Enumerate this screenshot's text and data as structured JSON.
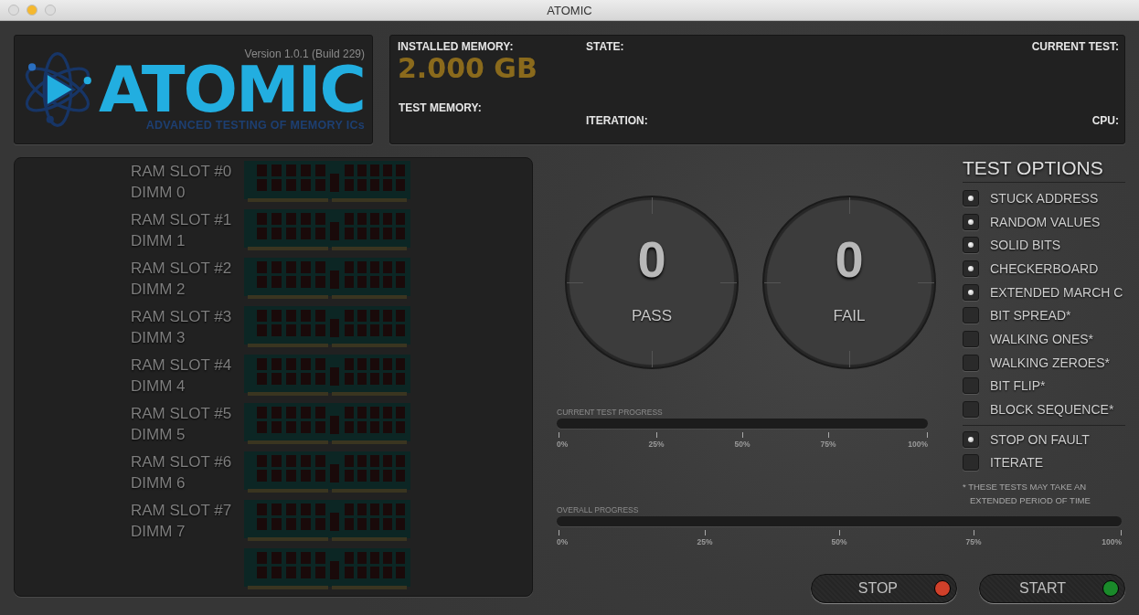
{
  "window": {
    "title": "ATOMIC"
  },
  "logo": {
    "version": "Version 1.0.1 (Build 229)",
    "name": "ATOMIC",
    "tagline": "ADVANCED TESTING OF MEMORY ICs"
  },
  "info": {
    "installed_memory_label": "INSTALLED MEMORY:",
    "installed_memory": "2.000 GB",
    "test_memory_label": "TEST MEMORY:",
    "state_label": "STATE:",
    "iteration_label": "ITERATION:",
    "current_test_label": "CURRENT TEST:",
    "cpu_label": "CPU:"
  },
  "slots": [
    {
      "slot": "RAM SLOT #0",
      "dimm": "DIMM 0"
    },
    {
      "slot": "RAM SLOT #1",
      "dimm": "DIMM 1"
    },
    {
      "slot": "RAM SLOT #2",
      "dimm": "DIMM 2"
    },
    {
      "slot": "RAM SLOT #3",
      "dimm": "DIMM 3"
    },
    {
      "slot": "RAM SLOT #4",
      "dimm": "DIMM 4"
    },
    {
      "slot": "RAM SLOT #5",
      "dimm": "DIMM 5"
    },
    {
      "slot": "RAM SLOT #6",
      "dimm": "DIMM 6"
    },
    {
      "slot": "RAM SLOT #7",
      "dimm": "DIMM 7"
    }
  ],
  "counters": [
    {
      "value": "0",
      "label": "PASS"
    },
    {
      "value": "0",
      "label": "FAIL"
    }
  ],
  "test_options": {
    "title": "TEST OPTIONS",
    "tests": [
      {
        "label": "STUCK ADDRESS",
        "checked": true
      },
      {
        "label": "RANDOM VALUES",
        "checked": true
      },
      {
        "label": "SOLID BITS",
        "checked": true
      },
      {
        "label": "CHECKERBOARD",
        "checked": true
      },
      {
        "label": "EXTENDED MARCH C",
        "checked": true
      },
      {
        "label": "BIT SPREAD*",
        "checked": false
      },
      {
        "label": "WALKING ONES*",
        "checked": false
      },
      {
        "label": "WALKING ZEROES*",
        "checked": false
      },
      {
        "label": "BIT FLIP*",
        "checked": false
      },
      {
        "label": "BLOCK SEQUENCE*",
        "checked": false
      }
    ],
    "settings": [
      {
        "label": "STOP ON FAULT",
        "checked": true
      },
      {
        "label": "ITERATE",
        "checked": false
      }
    ],
    "footnote": [
      "* THESE TESTS MAY TAKE AN",
      "EXTENDED PERIOD OF TIME"
    ]
  },
  "progress": [
    {
      "label": "CURRENT TEST PROGRESS",
      "level": 0,
      "ticks": [
        "0%",
        "25%",
        "50%",
        "75%",
        "100%"
      ]
    },
    {
      "label": "OVERALL PROGRESS",
      "level": 0,
      "ticks": [
        "0%",
        "25%",
        "50%",
        "75%",
        "100%"
      ]
    }
  ],
  "buttons": [
    {
      "label": "STOP",
      "color": "#d0402a"
    },
    {
      "label": "START",
      "color": "#1a8a2a"
    }
  ]
}
